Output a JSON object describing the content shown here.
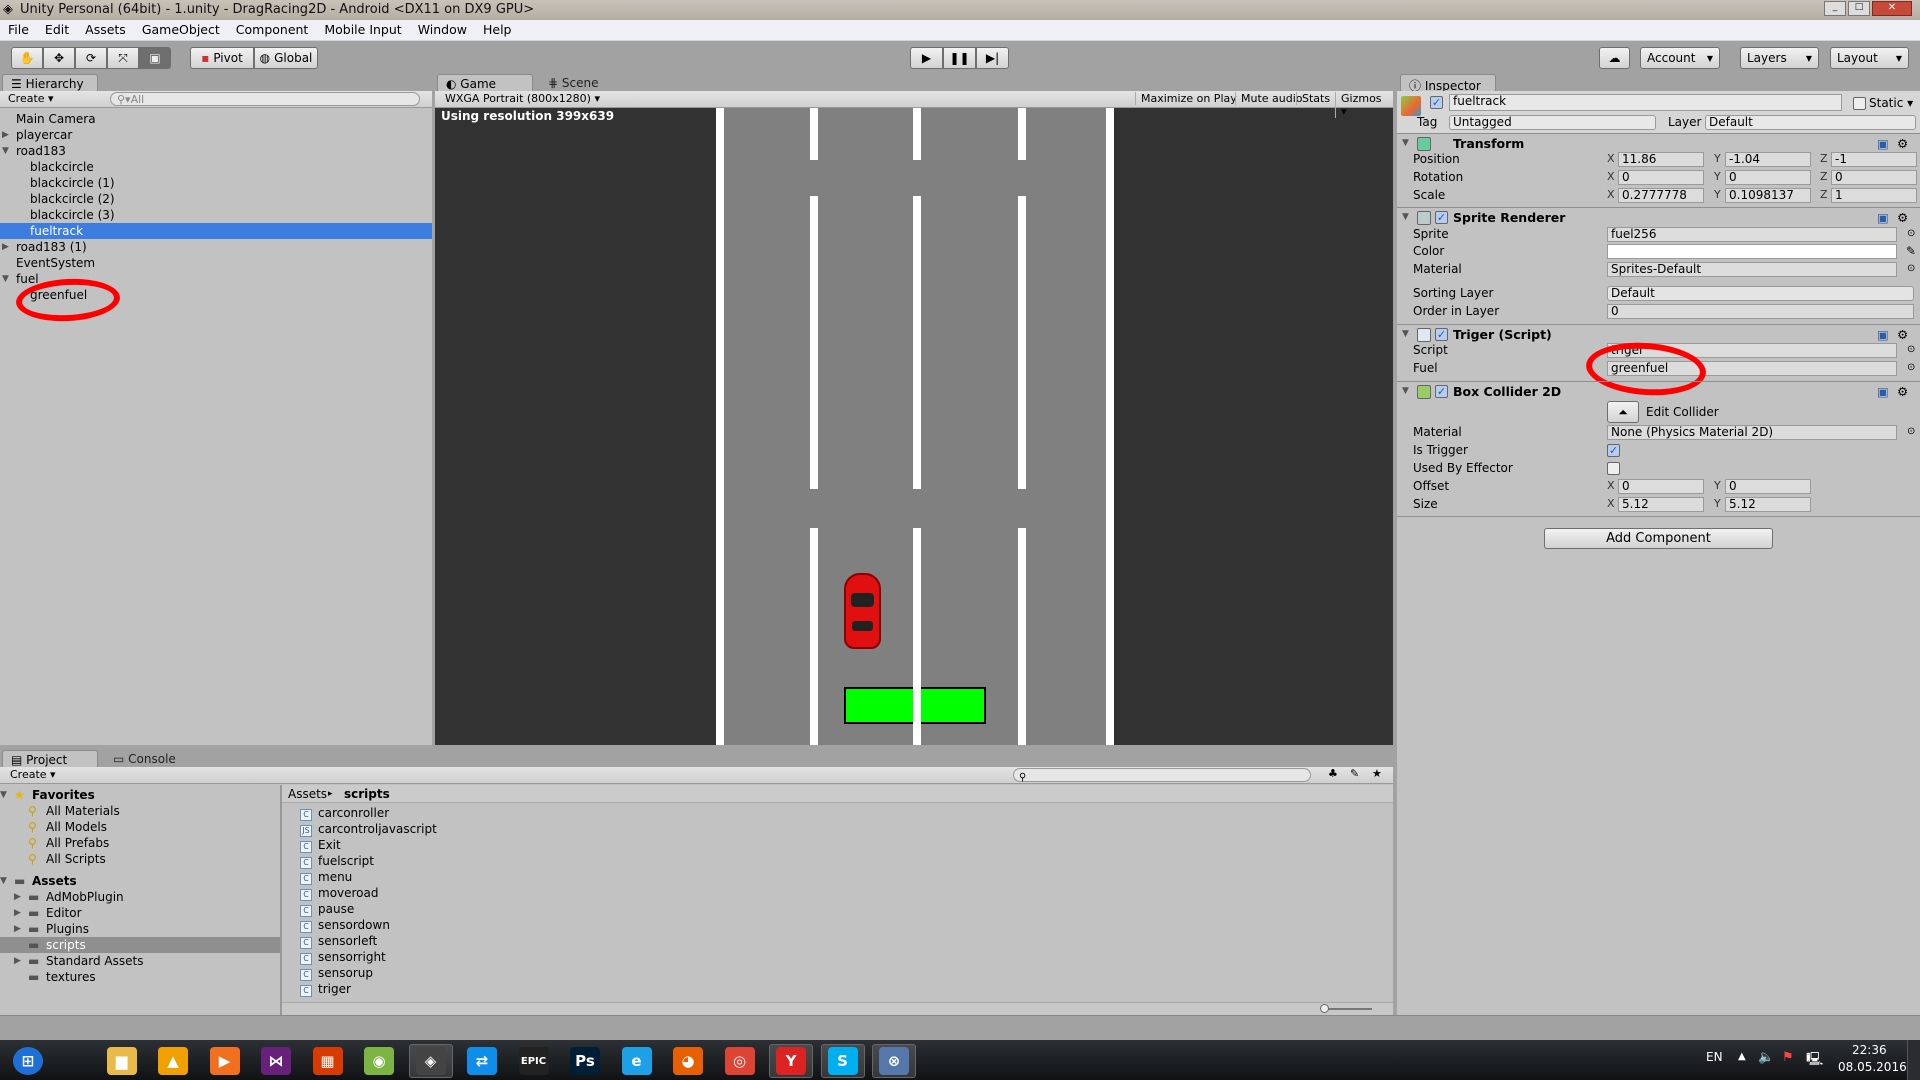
{
  "window": {
    "title": "Unity Personal (64bit) - 1.unity - DragRacing2D - Android <DX11 on DX9 GPU>"
  },
  "menu": [
    "File",
    "Edit",
    "Assets",
    "GameObject",
    "Component",
    "Mobile Input",
    "Window",
    "Help"
  ],
  "toolbar": {
    "pivot": "Pivot",
    "global": "Global",
    "account": "Account",
    "layers": "Layers",
    "layout": "Layout",
    "tools": [
      "hand-icon",
      "move-icon",
      "rotate-icon",
      "scale-icon",
      "rect-icon"
    ]
  },
  "hierarchy": {
    "tab": "Hierarchy",
    "create": "Create",
    "search_placeholder": "All",
    "items": [
      {
        "label": "Main Camera",
        "depth": 0,
        "arrow": ""
      },
      {
        "label": "playercar",
        "depth": 0,
        "arrow": "collapsed"
      },
      {
        "label": "road183",
        "depth": 0,
        "arrow": "expanded"
      },
      {
        "label": "blackcircle",
        "depth": 1,
        "arrow": ""
      },
      {
        "label": "blackcircle (1)",
        "depth": 1,
        "arrow": ""
      },
      {
        "label": "blackcircle (2)",
        "depth": 1,
        "arrow": ""
      },
      {
        "label": "blackcircle (3)",
        "depth": 1,
        "arrow": ""
      },
      {
        "label": "fueltrack",
        "depth": 1,
        "arrow": "",
        "selected": true
      },
      {
        "label": "road183 (1)",
        "depth": 0,
        "arrow": "collapsed"
      },
      {
        "label": "EventSystem",
        "depth": 0,
        "arrow": ""
      },
      {
        "label": "fuel",
        "depth": 0,
        "arrow": "expanded"
      },
      {
        "label": "greenfuel",
        "depth": 1,
        "arrow": ""
      }
    ]
  },
  "game": {
    "tab_game": "Game",
    "tab_scene": "Scene",
    "resolution": "WXGA Portrait (800x1280)",
    "maximize": "Maximize on Play",
    "mute": "Mute audio",
    "stats": "Stats",
    "gizmos": "Gizmos",
    "overlay": "Using resolution 399x639",
    "colors": {
      "background": "#323232",
      "road": "#808080",
      "car": "#e01010",
      "fuel": "#00ff00"
    }
  },
  "inspector": {
    "tab": "Inspector",
    "name": "fueltrack",
    "static": "Static",
    "tag_label": "Tag",
    "tag": "Untagged",
    "layer_label": "Layer",
    "layer": "Default",
    "transform": {
      "title": "Transform",
      "position_label": "Position",
      "rotation_label": "Rotation",
      "scale_label": "Scale",
      "position": [
        "11.86",
        "-1.04",
        "-1"
      ],
      "rotation": [
        "0",
        "0",
        "0"
      ],
      "scale": [
        "0.2777778",
        "0.1098137",
        "1"
      ]
    },
    "sprite_renderer": {
      "title": "Sprite Renderer",
      "sprite_label": "Sprite",
      "sprite": "fuel256",
      "color_label": "Color",
      "material_label": "Material",
      "material": "Sprites-Default",
      "sorting_label": "Sorting Layer",
      "sorting": "Default",
      "order_label": "Order in Layer",
      "order": "0"
    },
    "triger": {
      "title": "Triger (Script)",
      "script_label": "Script",
      "script": "triger",
      "fuel_label": "Fuel",
      "fuel": "greenfuel"
    },
    "box_collider": {
      "title": "Box Collider 2D",
      "edit": "Edit Collider",
      "material_label": "Material",
      "material": "None (Physics Material 2D)",
      "trigger_label": "Is Trigger",
      "is_trigger": true,
      "effector_label": "Used By Effector",
      "used_by_effector": false,
      "offset_label": "Offset",
      "offset": [
        "0",
        "0"
      ],
      "size_label": "Size",
      "size": [
        "5.12",
        "5.12"
      ]
    },
    "add_component": "Add Component"
  },
  "project": {
    "tab": "Project",
    "console_tab": "Console",
    "create": "Create",
    "favorites_label": "Favorites",
    "favorites": [
      "All Materials",
      "All Models",
      "All Prefabs",
      "All Scripts"
    ],
    "assets_label": "Assets",
    "assets": [
      {
        "label": "AdMobPlugin",
        "arrow": true
      },
      {
        "label": "Editor",
        "arrow": true
      },
      {
        "label": "Plugins",
        "arrow": true
      },
      {
        "label": "scripts",
        "arrow": false,
        "selected": true
      },
      {
        "label": "Standard Assets",
        "arrow": true
      },
      {
        "label": "textures",
        "arrow": false
      }
    ],
    "breadcrumb": [
      "Assets",
      "scripts"
    ],
    "files": [
      {
        "label": "carconroller",
        "type": "cs"
      },
      {
        "label": "carcontroljavascript",
        "type": "js"
      },
      {
        "label": "Exit",
        "type": "cs"
      },
      {
        "label": "fuelscript",
        "type": "cs"
      },
      {
        "label": "menu",
        "type": "cs"
      },
      {
        "label": "moveroad",
        "type": "cs"
      },
      {
        "label": "pause",
        "type": "cs"
      },
      {
        "label": "sensordown",
        "type": "cs"
      },
      {
        "label": "sensorleft",
        "type": "cs"
      },
      {
        "label": "sensorright",
        "type": "cs"
      },
      {
        "label": "sensorup",
        "type": "cs"
      },
      {
        "label": "triger",
        "type": "cs"
      }
    ]
  },
  "taskbar": {
    "lang": "EN",
    "time": "22:36",
    "date": "08.05.2016",
    "apps": [
      "windows-start",
      "explorer",
      "aimp",
      "media-player",
      "visual-studio",
      "office",
      "android-studio",
      "unity",
      "teamviewer",
      "epic-games",
      "photoshop",
      "internet-explorer",
      "firefox",
      "chrome",
      "yandex",
      "skype",
      "network-app"
    ],
    "app_labels": {
      "epic": "EPIC",
      "ps": "Ps",
      "s": "S",
      "y": "Y",
      "e": "e"
    }
  }
}
